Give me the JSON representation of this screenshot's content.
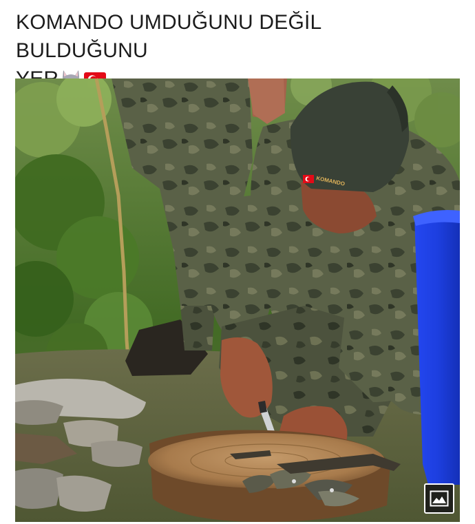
{
  "post": {
    "caption_line1": "KOMANDO UMDUĞUNU DEĞİL BULDUĞUNU",
    "caption_line2": "YER",
    "emojis": [
      "wolf-face-emoji",
      "turkey-flag-emoji"
    ]
  },
  "photo": {
    "helmet_text": "KOMANDO",
    "gallery_button_icon": "image-gallery-icon"
  },
  "colors": {
    "bucket_blue": "#1d3fe0",
    "flag_red": "#e30a17",
    "camo_dark": "#3e4532",
    "foliage_green": "#4f7a2a"
  }
}
